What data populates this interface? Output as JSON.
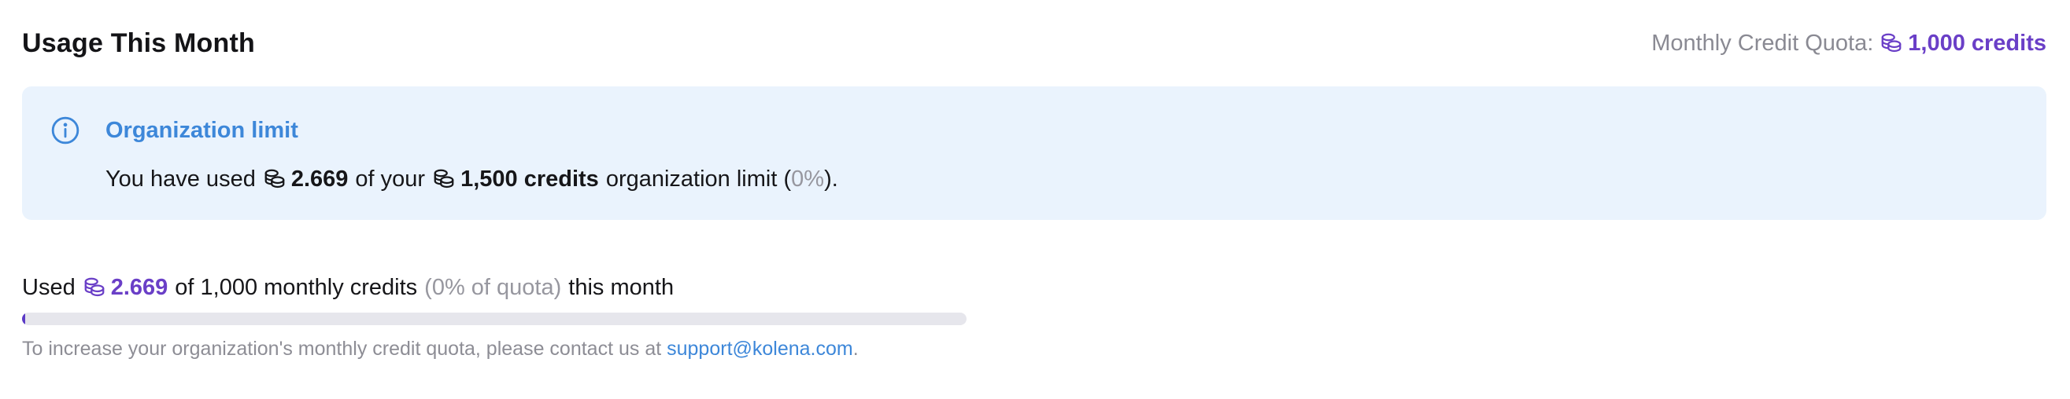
{
  "header": {
    "title": "Usage This Month",
    "quota_label": "Monthly Credit Quota:",
    "quota_value": "1,000 credits"
  },
  "banner": {
    "title": "Organization limit",
    "text_1": "You have used",
    "used": "2.669",
    "text_2": "of your",
    "limit": "1,500 credits",
    "text_3": "organization limit (",
    "percent": "0%",
    "text_4": ")."
  },
  "usage": {
    "prefix": "Used",
    "used": "2.669",
    "text_1": "of 1,000 monthly credits",
    "quota_percent": "(0% of quota)",
    "text_2": "this month",
    "progress_fraction": 0.003
  },
  "footnote": {
    "text": "To increase your organization's monthly credit quota, please contact us at",
    "email": "support@kolena.com",
    "suffix": "."
  },
  "colors": {
    "accent": "#6a3fc7",
    "info_blue": "#3d87d9",
    "banner_bg": "#eaf3fd",
    "progress_track": "#e6e6ec",
    "progress_fill": "#5b3ac6"
  },
  "icons": {
    "credit": "coins-icon",
    "info": "info-icon"
  }
}
